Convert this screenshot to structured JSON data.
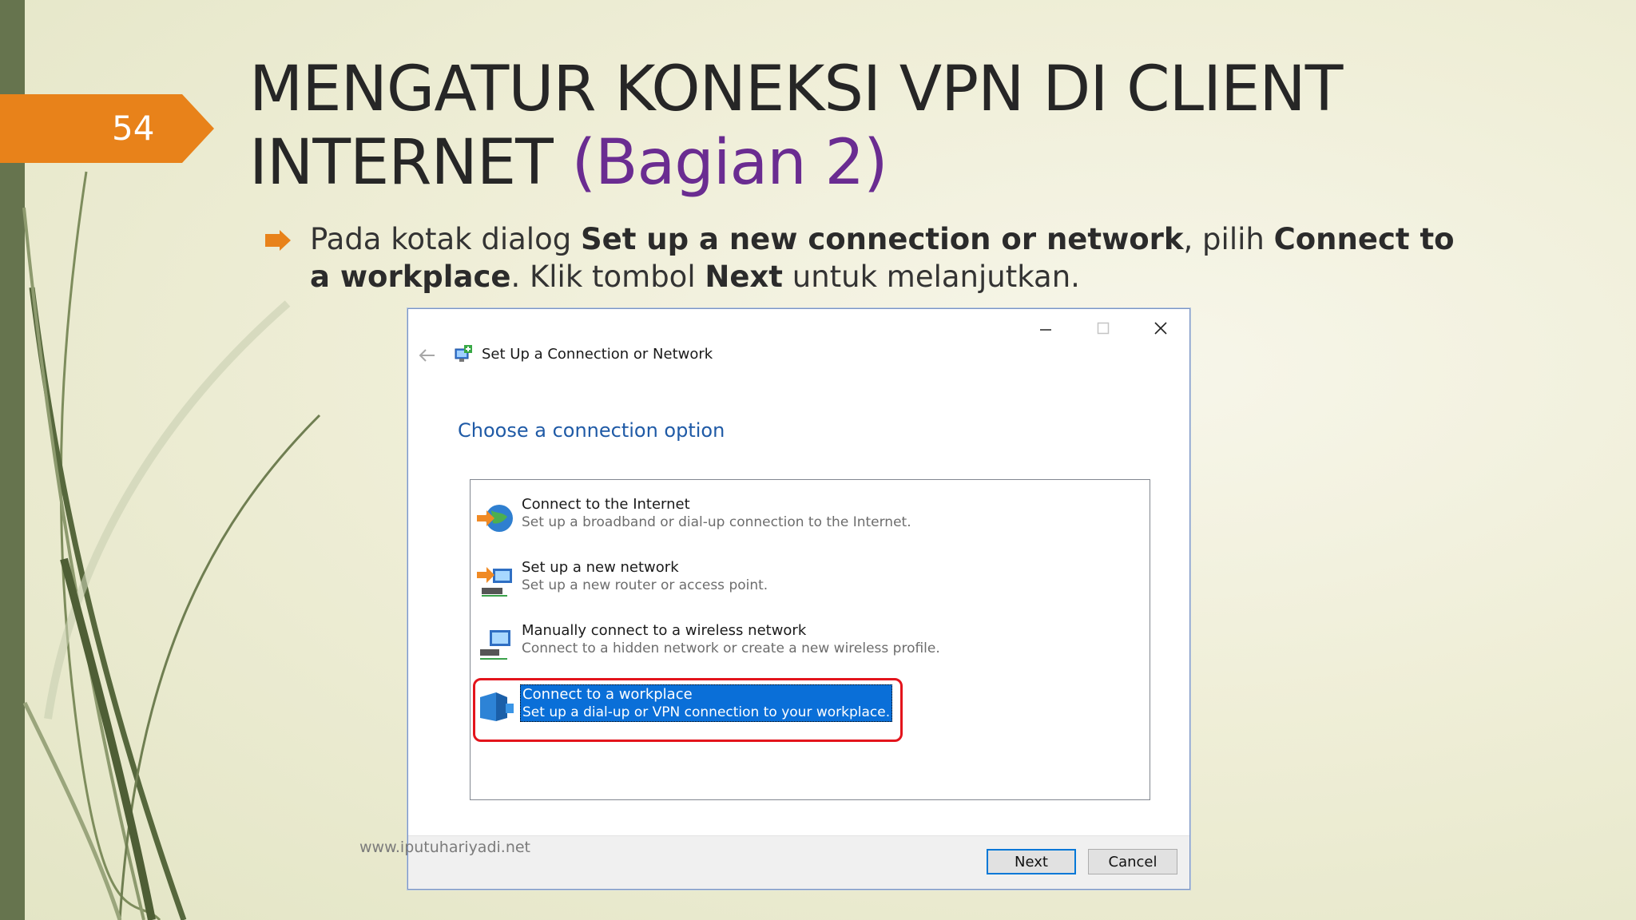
{
  "slide": {
    "number": "54",
    "title_main": "MENGATUR KONEKSI VPN DI CLIENT INTERNET",
    "title_accent": "(Bagian 2)",
    "bullet": {
      "p1": "Pada kotak dialog ",
      "b1": "Set up a new connection or network",
      "p2": ", pilih ",
      "b2": "Connect to a workplace",
      "p3": ". Klik tombol ",
      "b3": "Next",
      "p4": " untuk melanjutkan."
    },
    "watermark": "www.iputuhariyadi.net"
  },
  "dialog": {
    "title": "Set Up a Connection or Network",
    "heading": "Choose a connection option",
    "options": [
      {
        "title": "Connect to the Internet",
        "desc": "Set up a broadband or dial-up connection to the Internet."
      },
      {
        "title": "Set up a new network",
        "desc": "Set up a new router or access point."
      },
      {
        "title": "Manually connect to a wireless network",
        "desc": "Connect to a hidden network or create a new wireless profile."
      },
      {
        "title": "Connect to a workplace",
        "desc": "Set up a dial-up or VPN connection to your workplace."
      }
    ],
    "buttons": {
      "next": "Next",
      "cancel": "Cancel"
    }
  },
  "colors": {
    "badge": "#e8821a",
    "accent_title": "#6a2c91",
    "selection": "#0a6fd8",
    "highlight_outline": "#e3141c",
    "heading_blue": "#1f5aa6"
  }
}
